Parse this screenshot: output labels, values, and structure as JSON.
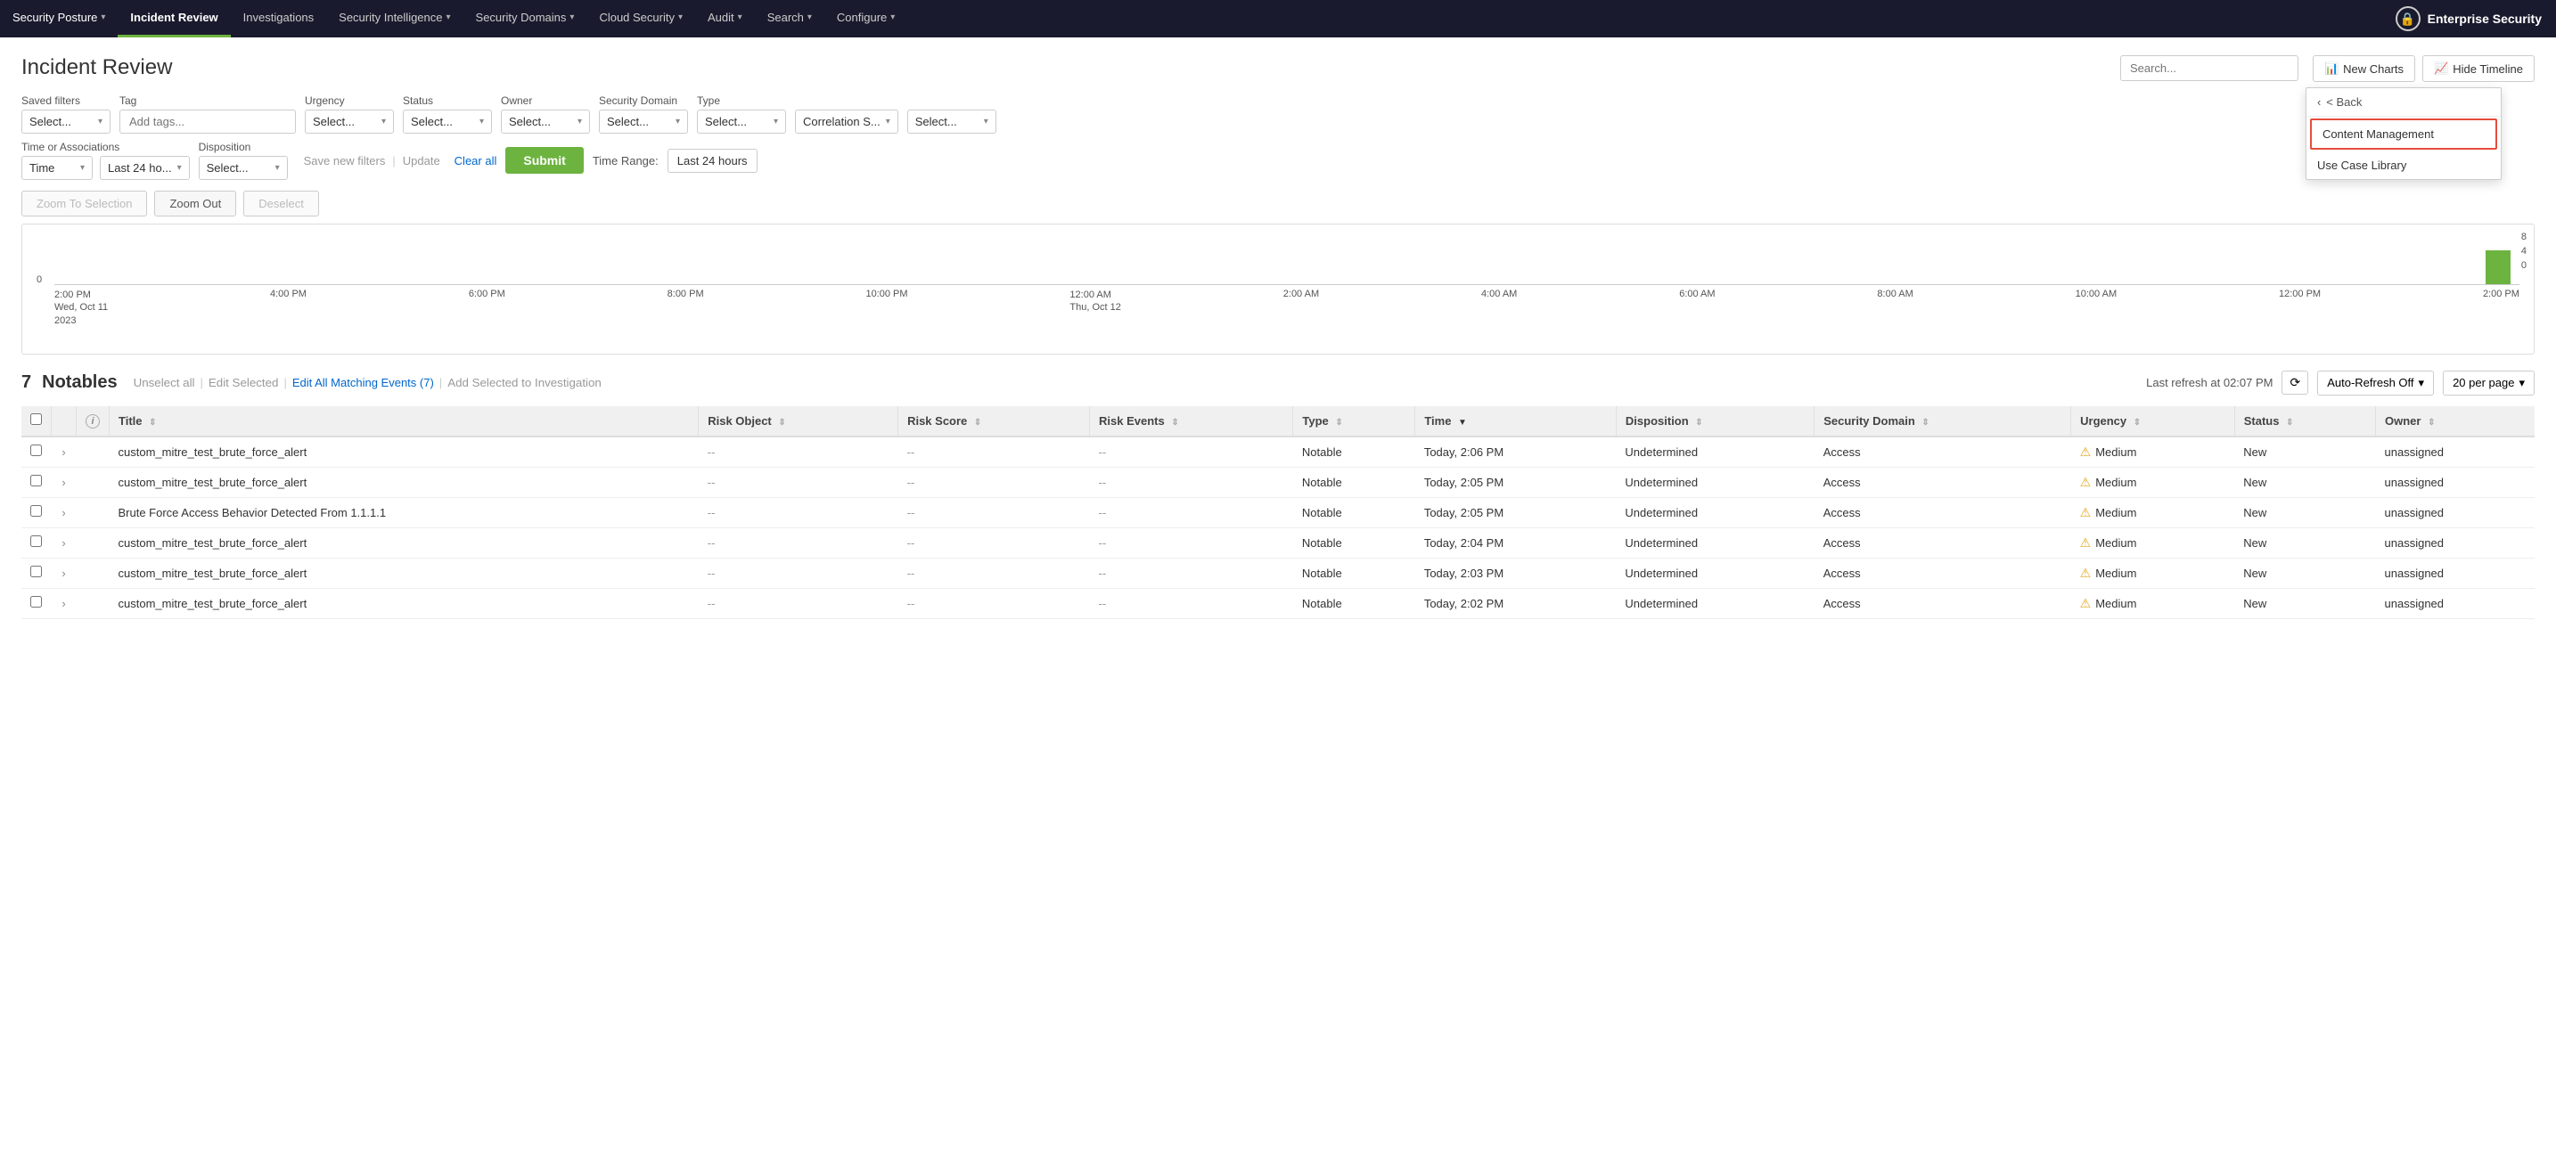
{
  "nav": {
    "items": [
      {
        "label": "Security Posture",
        "hasDropdown": true,
        "active": false
      },
      {
        "label": "Incident Review",
        "hasDropdown": false,
        "active": true
      },
      {
        "label": "Investigations",
        "hasDropdown": false,
        "active": false
      },
      {
        "label": "Security Intelligence",
        "hasDropdown": true,
        "active": false
      },
      {
        "label": "Security Domains",
        "hasDropdown": true,
        "active": false
      },
      {
        "label": "Cloud Security",
        "hasDropdown": true,
        "active": false
      },
      {
        "label": "Audit",
        "hasDropdown": true,
        "active": false
      },
      {
        "label": "Search",
        "hasDropdown": true,
        "active": false
      },
      {
        "label": "Configure",
        "hasDropdown": true,
        "active": false
      }
    ],
    "brand": "Enterprise Security",
    "brandIcon": "🔒"
  },
  "header": {
    "title": "Incident Review",
    "search_placeholder": "Search...",
    "btn_new_charts": "New Charts",
    "btn_hide_timeline": "Hide Timeline",
    "configure_dropdown": {
      "back_label": "< Back",
      "items": [
        {
          "label": "Content Management",
          "highlighted": true
        },
        {
          "label": "Use Case Library",
          "highlighted": false
        }
      ]
    }
  },
  "filters": {
    "saved_filters_label": "Saved filters",
    "saved_filters_placeholder": "Select...",
    "tag_label": "Tag",
    "tag_placeholder": "Add tags...",
    "urgency_label": "Urgency",
    "urgency_placeholder": "Select...",
    "status_label": "Status",
    "status_placeholder": "Select...",
    "owner_label": "Owner",
    "owner_placeholder": "Select...",
    "security_domain_label": "Security Domain",
    "security_domain_placeholder": "Select...",
    "type_label": "Type",
    "type_placeholder": "Select...",
    "correlation_placeholder": "Correlation S...",
    "extra_placeholder": "Select...",
    "time_or_associations_label": "Time or Associations",
    "time_placeholder": "Time",
    "disposition_label": "Disposition",
    "last_label": "Last 24 ho...",
    "disp_placeholder": "Select...",
    "save_new_filters": "Save new filters",
    "update": "Update",
    "clear_all": "Clear all",
    "submit": "Submit",
    "time_range_label": "Time Range:",
    "time_range_value": "Last 24 hours"
  },
  "zoom": {
    "zoom_to_selection": "Zoom To Selection",
    "zoom_out": "Zoom Out",
    "deselect": "Deselect"
  },
  "timeline": {
    "y_labels": [
      "8",
      "4",
      "0"
    ],
    "zero_label": "0",
    "x_labels": [
      "2:00 PM\nWed, Oct 11\n2023",
      "4:00 PM",
      "6:00 PM",
      "8:00 PM",
      "10:00 PM",
      "12:00 AM\nThu, Oct 12",
      "2:00 AM",
      "4:00 AM",
      "6:00 AM",
      "8:00 AM",
      "10:00 AM",
      "12:00 PM",
      "2:00 PM"
    ]
  },
  "notables": {
    "count": "7",
    "count_label": "Notables",
    "unselect_all": "Unselect all",
    "edit_selected": "Edit Selected",
    "edit_all_matching": "Edit All Matching Events (7)",
    "add_to_investigation": "Add Selected to Investigation",
    "last_refresh": "Last refresh at 02:07 PM",
    "auto_refresh": "Auto-Refresh Off",
    "per_page": "20 per page"
  },
  "table": {
    "columns": [
      {
        "label": "",
        "key": "checkbox"
      },
      {
        "label": "",
        "key": "expand"
      },
      {
        "label": "i",
        "key": "info"
      },
      {
        "label": "Title",
        "key": "title",
        "sortable": true
      },
      {
        "label": "Risk Object",
        "key": "risk_object",
        "sortable": true
      },
      {
        "label": "Risk Score",
        "key": "risk_score",
        "sortable": true
      },
      {
        "label": "Risk Events",
        "key": "risk_events",
        "sortable": true
      },
      {
        "label": "Type",
        "key": "type",
        "sortable": true
      },
      {
        "label": "Time",
        "key": "time",
        "sortable": true,
        "sorted": true
      },
      {
        "label": "Disposition",
        "key": "disposition",
        "sortable": true
      },
      {
        "label": "Security Domain",
        "key": "security_domain",
        "sortable": true
      },
      {
        "label": "Urgency",
        "key": "urgency",
        "sortable": true
      },
      {
        "label": "Status",
        "key": "status",
        "sortable": true
      },
      {
        "label": "Owner",
        "key": "owner",
        "sortable": true
      }
    ],
    "rows": [
      {
        "title": "custom_mitre_test_brute_force_alert",
        "risk_object": "--",
        "risk_score": "--",
        "risk_events": "--",
        "type": "Notable",
        "time": "Today, 2:06 PM",
        "disposition": "Undetermined",
        "security_domain": "Access",
        "urgency": "Medium",
        "status": "New",
        "owner": "unassigned"
      },
      {
        "title": "custom_mitre_test_brute_force_alert",
        "risk_object": "--",
        "risk_score": "--",
        "risk_events": "--",
        "type": "Notable",
        "time": "Today, 2:05 PM",
        "disposition": "Undetermined",
        "security_domain": "Access",
        "urgency": "Medium",
        "status": "New",
        "owner": "unassigned"
      },
      {
        "title": "Brute Force Access Behavior Detected From 1.1.1.1",
        "risk_object": "--",
        "risk_score": "--",
        "risk_events": "--",
        "type": "Notable",
        "time": "Today, 2:05 PM",
        "disposition": "Undetermined",
        "security_domain": "Access",
        "urgency": "Medium",
        "status": "New",
        "owner": "unassigned"
      },
      {
        "title": "custom_mitre_test_brute_force_alert",
        "risk_object": "--",
        "risk_score": "--",
        "risk_events": "--",
        "type": "Notable",
        "time": "Today, 2:04 PM",
        "disposition": "Undetermined",
        "security_domain": "Access",
        "urgency": "Medium",
        "status": "New",
        "owner": "unassigned"
      },
      {
        "title": "custom_mitre_test_brute_force_alert",
        "risk_object": "--",
        "risk_score": "--",
        "risk_events": "--",
        "type": "Notable",
        "time": "Today, 2:03 PM",
        "disposition": "Undetermined",
        "security_domain": "Access",
        "urgency": "Medium",
        "status": "New",
        "owner": "unassigned"
      },
      {
        "title": "custom_mitre_test_brute_force_alert",
        "risk_object": "--",
        "risk_score": "--",
        "risk_events": "--",
        "type": "Notable",
        "time": "Today, 2:02 PM",
        "disposition": "Undetermined",
        "security_domain": "Access",
        "urgency": "Medium",
        "status": "New",
        "owner": "unassigned"
      }
    ]
  }
}
